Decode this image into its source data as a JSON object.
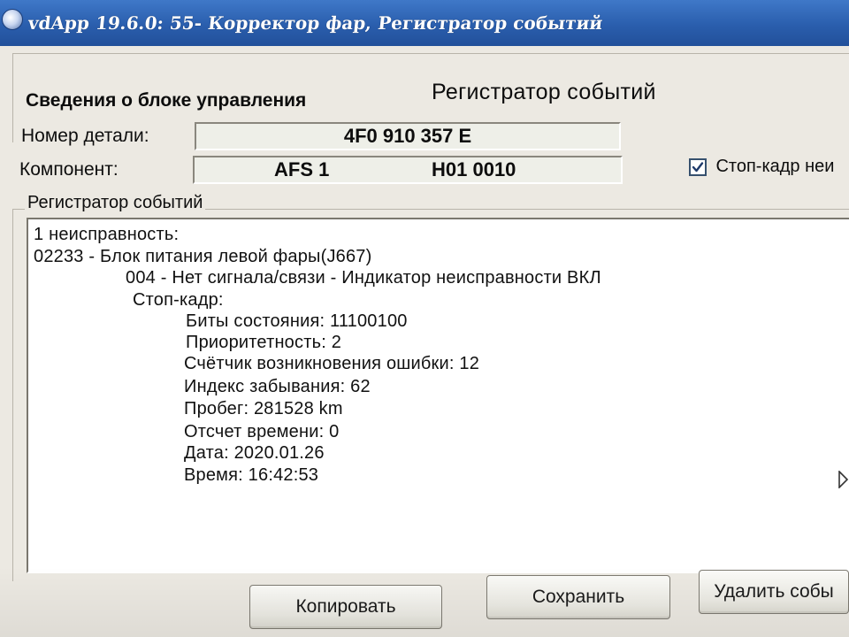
{
  "window": {
    "title": "vdApp 19.6.0: 55- Корректор фар,  Регистратор событий"
  },
  "unit_info": {
    "group_label": "Сведения о блоке управления",
    "section_title": "Регистратор событий",
    "part_number_label": "Номер детали:",
    "part_number_value": "4F0 910 357 E",
    "component_label": "Компонент:",
    "component_name": "AFS 1",
    "component_version": "H01 0010",
    "freeze_frame_checkbox": {
      "label": "Стоп-кадр неи",
      "checked": true
    }
  },
  "events": {
    "group_label": "Регистратор событий",
    "lines": [
      "1 неисправность:",
      "02233 - Блок питания левой фары(J667)",
      "004 - Нет сигнала/связи - Индикатор неисправности ВКЛ",
      "Стоп-кадр:",
      "Биты состояния: 11100100",
      "Приоритетность: 2",
      "Счётчик возникновения ошибки: 12",
      "Индекс забывания: 62",
      "Пробег: 281528 km",
      "Отсчет времени: 0",
      "Дата: 2020.01.26",
      "Время: 16:42:53"
    ]
  },
  "buttons": {
    "copy": "Копировать",
    "save": "Сохранить",
    "delete": "Удалить собы"
  },
  "colors": {
    "titlebar": "#2a5ead",
    "window_bg": "#ece9e2",
    "field_bg": "#eeefe8",
    "log_bg": "#ffffff"
  }
}
